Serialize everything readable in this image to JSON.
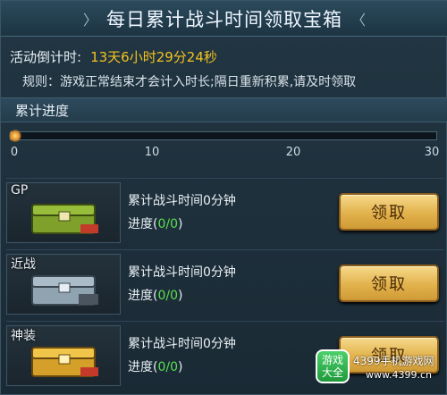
{
  "title": {
    "text": "每日累计战斗时间领取宝箱",
    "deco_left": "〉",
    "deco_right": "〈"
  },
  "countdown": {
    "label": "活动倒计时:",
    "value": "13天6小时29分24秒"
  },
  "rule": "规则：游戏正常结束才会计入时长;隔日重新积累,请及时领取",
  "progress": {
    "header": "累计进度",
    "fraction": 0.01,
    "ticks": [
      "0",
      "10",
      "20",
      "30"
    ]
  },
  "rewards": [
    {
      "tag": "GP",
      "label": "累计战斗时间0分钟",
      "progress_prefix": "进度(",
      "progress_value": "0/0",
      "progress_suffix": ")",
      "button": "领取",
      "chest_color": "#7fa12c"
    },
    {
      "tag": "近战",
      "label": "累计战斗时间0分钟",
      "progress_prefix": "进度(",
      "progress_value": "0/0",
      "progress_suffix": ")",
      "button": "领取",
      "chest_color": "#8fa3b0"
    },
    {
      "tag": "神装",
      "label": "累计战斗时间0分钟",
      "progress_prefix": "进度(",
      "progress_value": "0/0",
      "progress_suffix": ")",
      "button": "领取",
      "chest_color": "#d4a02a"
    }
  ],
  "watermark": {
    "logo": "游戏\n大全",
    "text": "4399手机游戏网",
    "url": "www.4399.cn"
  }
}
